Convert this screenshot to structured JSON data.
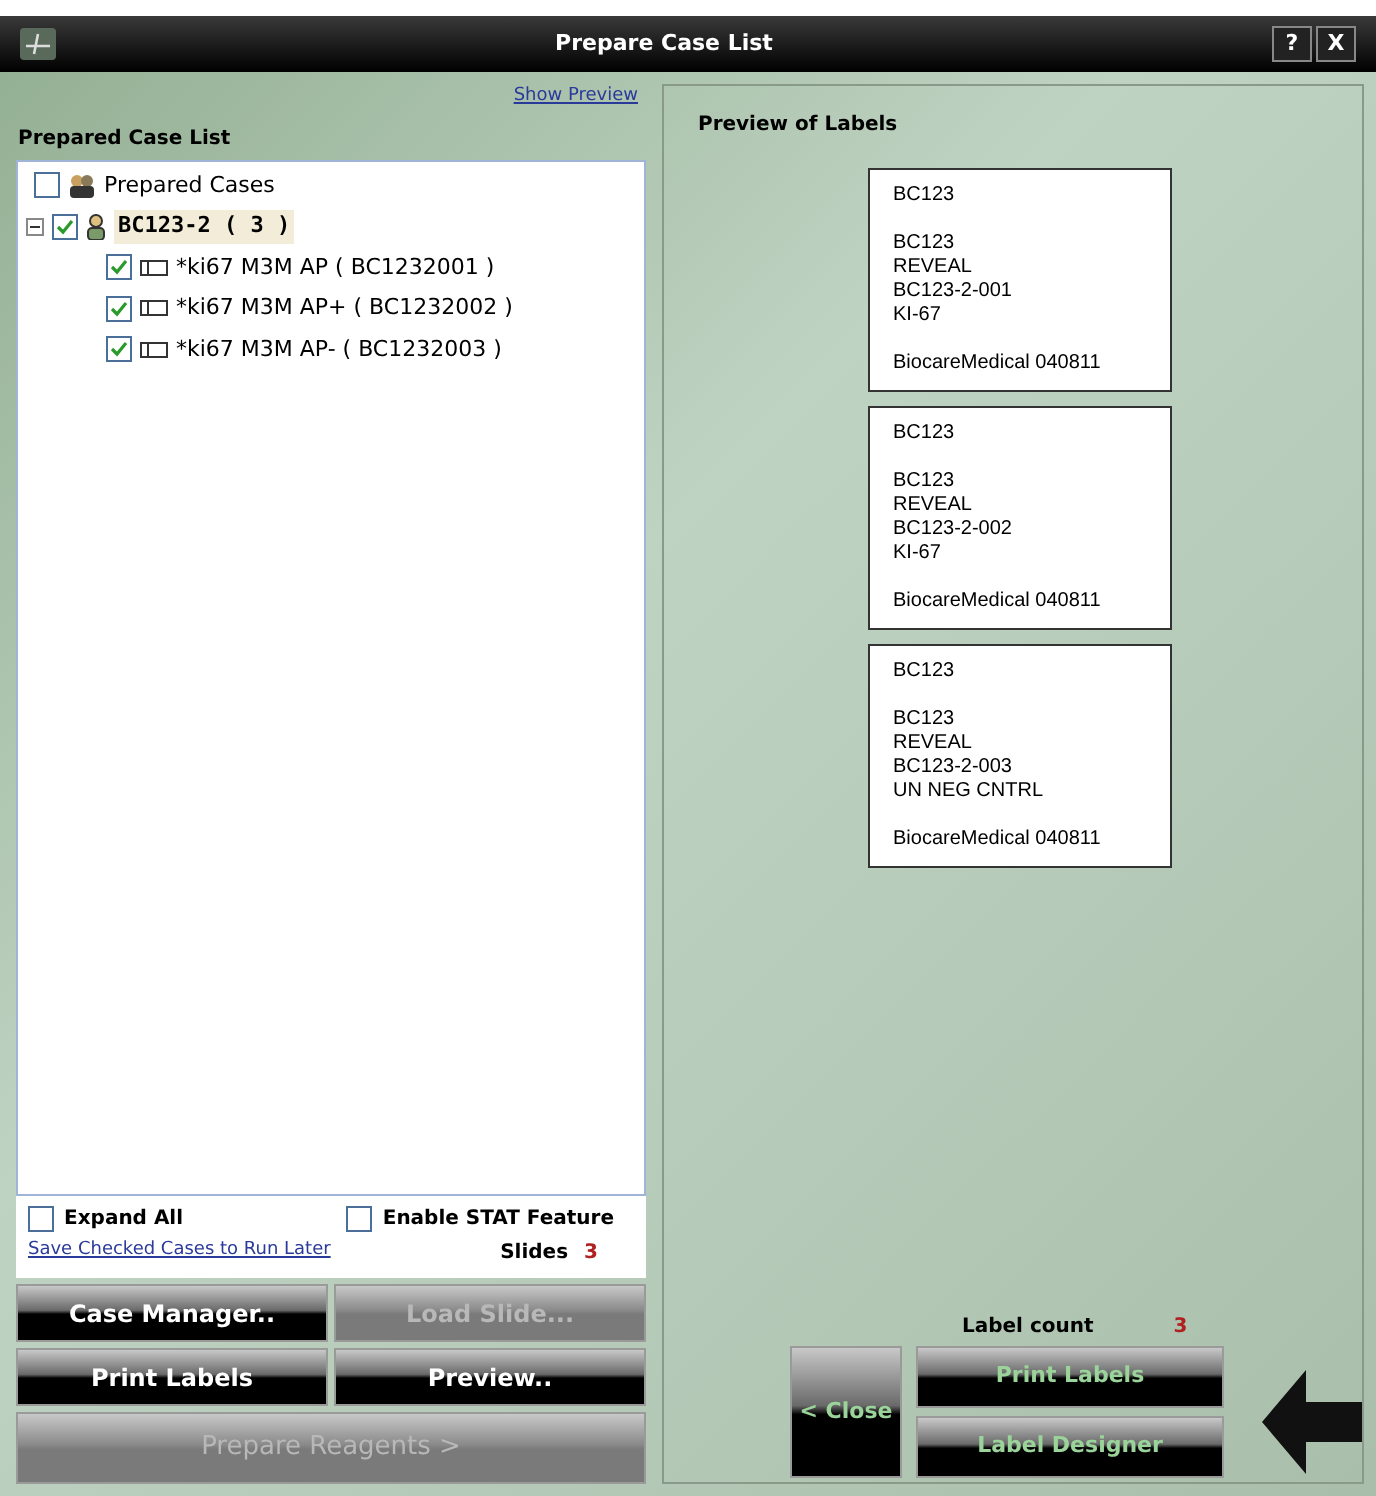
{
  "window": {
    "title": "Prepare Case List",
    "help": "?",
    "close": "X"
  },
  "left": {
    "show_preview": "Show Preview",
    "heading": "Prepared Case List",
    "tree": {
      "label": "Prepared Cases",
      "checked": false,
      "children": [
        {
          "label": "BC123-2 ( 3 )",
          "checked": true,
          "expanded": true,
          "selected": true,
          "children": [
            {
              "label": "*ki67 M3M AP ( BC1232001 )",
              "checked": true
            },
            {
              "label": "*ki67 M3M AP+ ( BC1232002 )",
              "checked": true
            },
            {
              "label": "*ki67 M3M AP- ( BC1232003 )",
              "checked": true
            }
          ]
        }
      ]
    },
    "options": [
      {
        "label": "Expand All",
        "checked": false
      },
      {
        "label": "Enable STAT Feature",
        "checked": false
      }
    ],
    "save_link": "Save Checked Cases to Run Later",
    "slides_label": "Slides",
    "slides_count": "3",
    "buttons": [
      {
        "label": "Case Manager..",
        "disabled": false
      },
      {
        "label": "Load Slide...",
        "disabled": true
      },
      {
        "label": "Print Labels",
        "disabled": false
      },
      {
        "label": "Preview..",
        "disabled": false
      }
    ],
    "wide_button": {
      "label": "Prepare Reagents >",
      "disabled": true
    }
  },
  "right": {
    "heading": "Preview of Labels",
    "labels": [
      {
        "header": "BC123",
        "lines": [
          "BC123",
          "REVEAL",
          "BC123-2-001",
          "KI-67"
        ],
        "footer": "BiocareMedical 040811"
      },
      {
        "header": "BC123",
        "lines": [
          "BC123",
          "REVEAL",
          "BC123-2-002",
          "KI-67"
        ],
        "footer": "BiocareMedical 040811"
      },
      {
        "header": "BC123",
        "lines": [
          "BC123",
          "REVEAL",
          "BC123-2-003",
          "UN NEG CNTRL"
        ],
        "footer": "BiocareMedical 040811"
      }
    ],
    "label_count_label": "Label count",
    "label_count": "3",
    "close_button": "< Close",
    "print_button": "Print Labels",
    "designer_button": "Label Designer"
  }
}
